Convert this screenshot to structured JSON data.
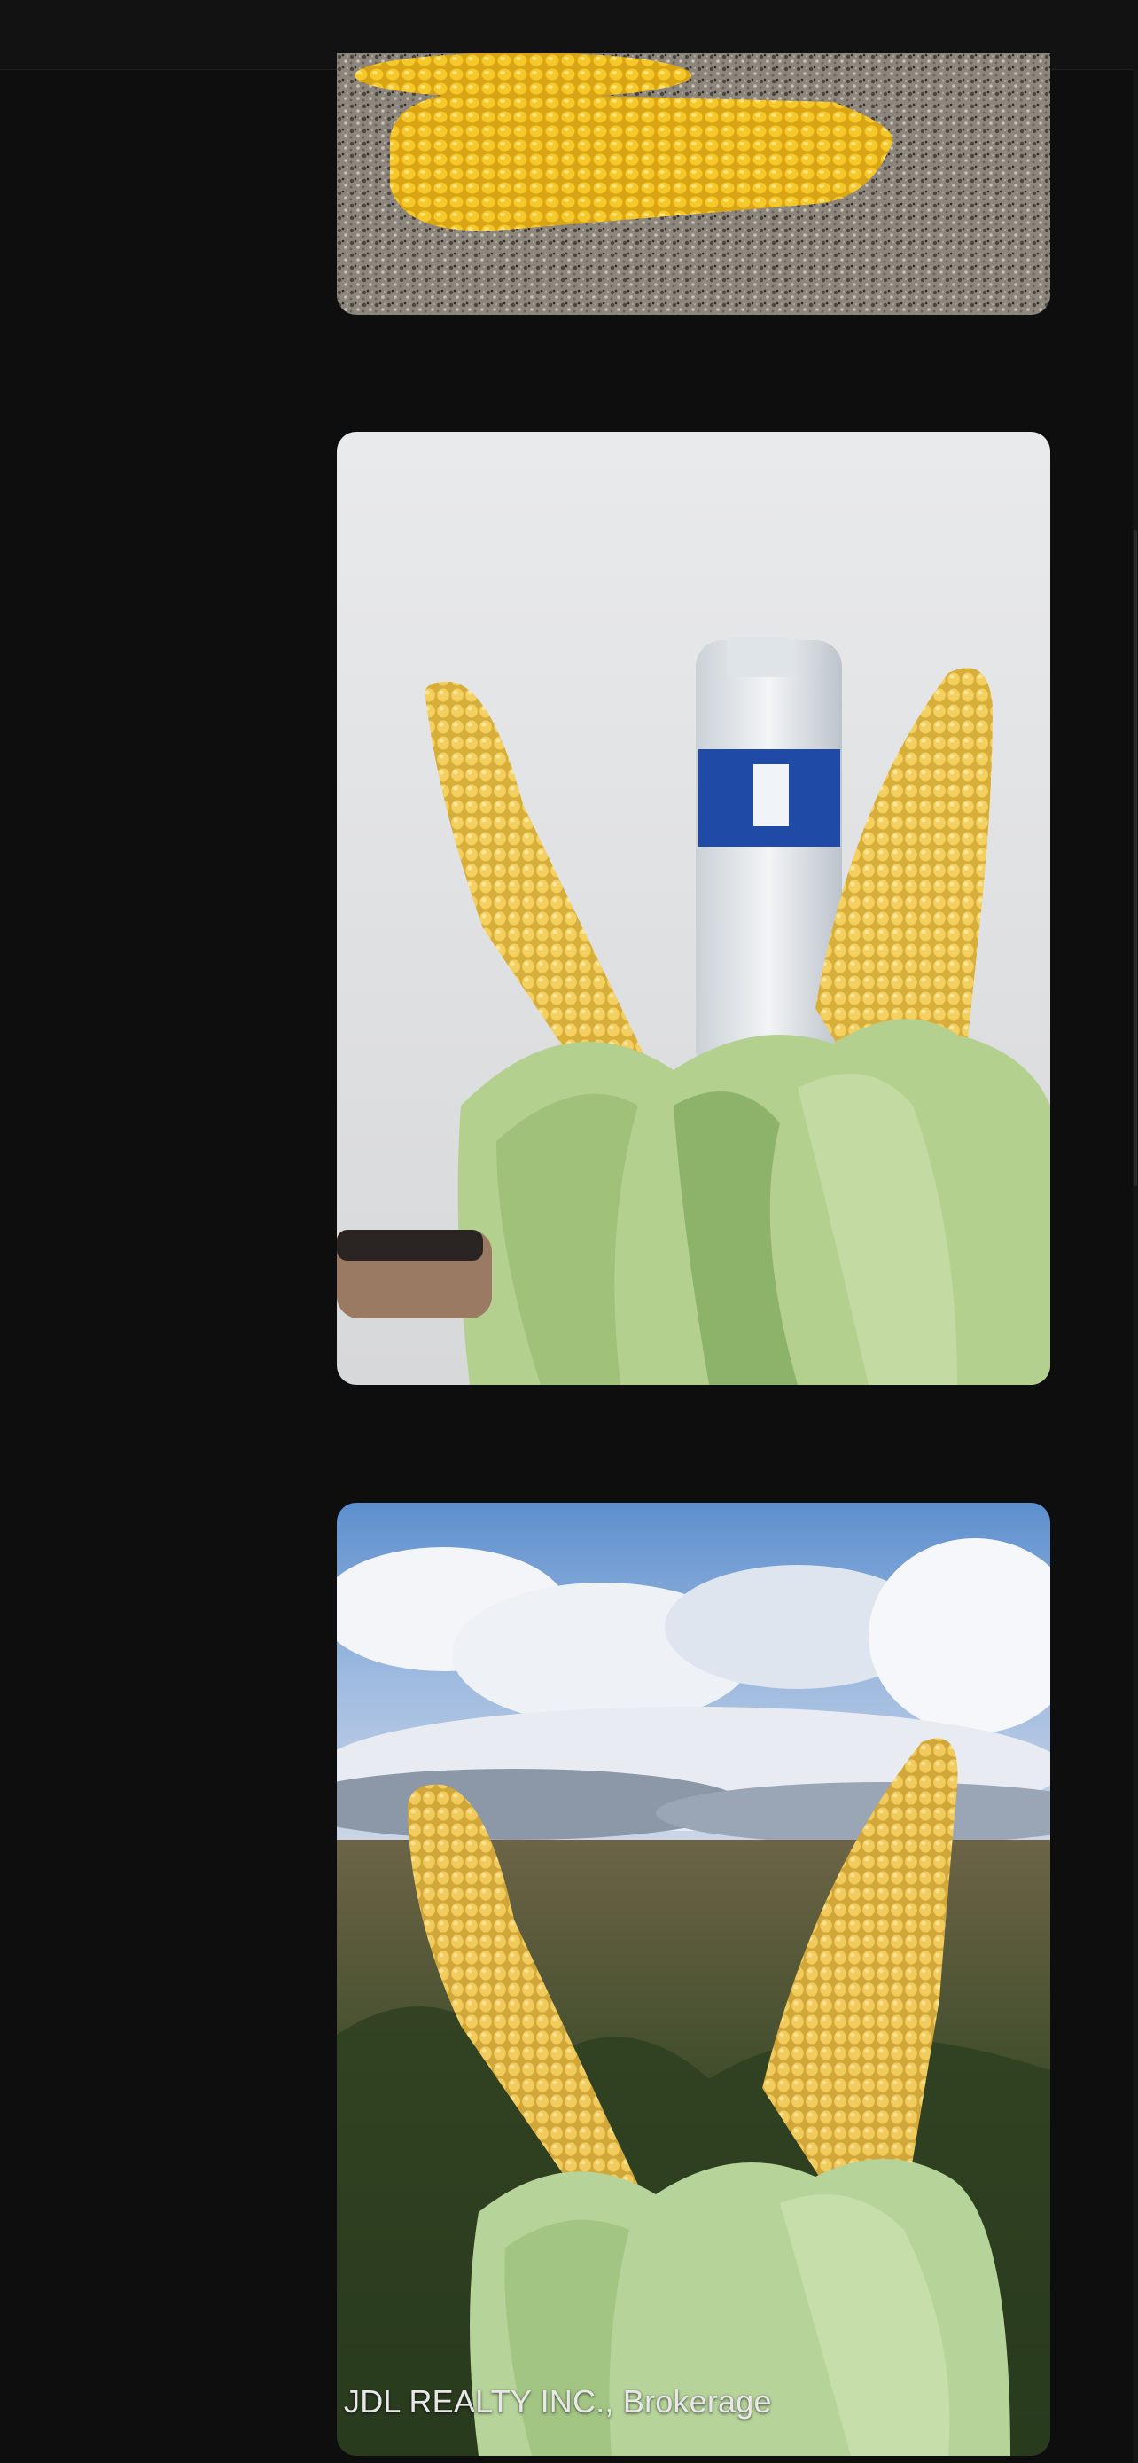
{
  "gallery": {
    "photos": [
      {
        "subject": "two yellow corn cobs on gravel"
      },
      {
        "subject": "two corn cobs with husks beside a water bottle"
      },
      {
        "subject": "two corn cobs held up against a cloudy sky over a cornfield"
      }
    ],
    "watermark": "JDL REALTY INC., Brokerage"
  },
  "colors": {
    "background": "#0e0e0f",
    "corn": "#f4c430"
  }
}
